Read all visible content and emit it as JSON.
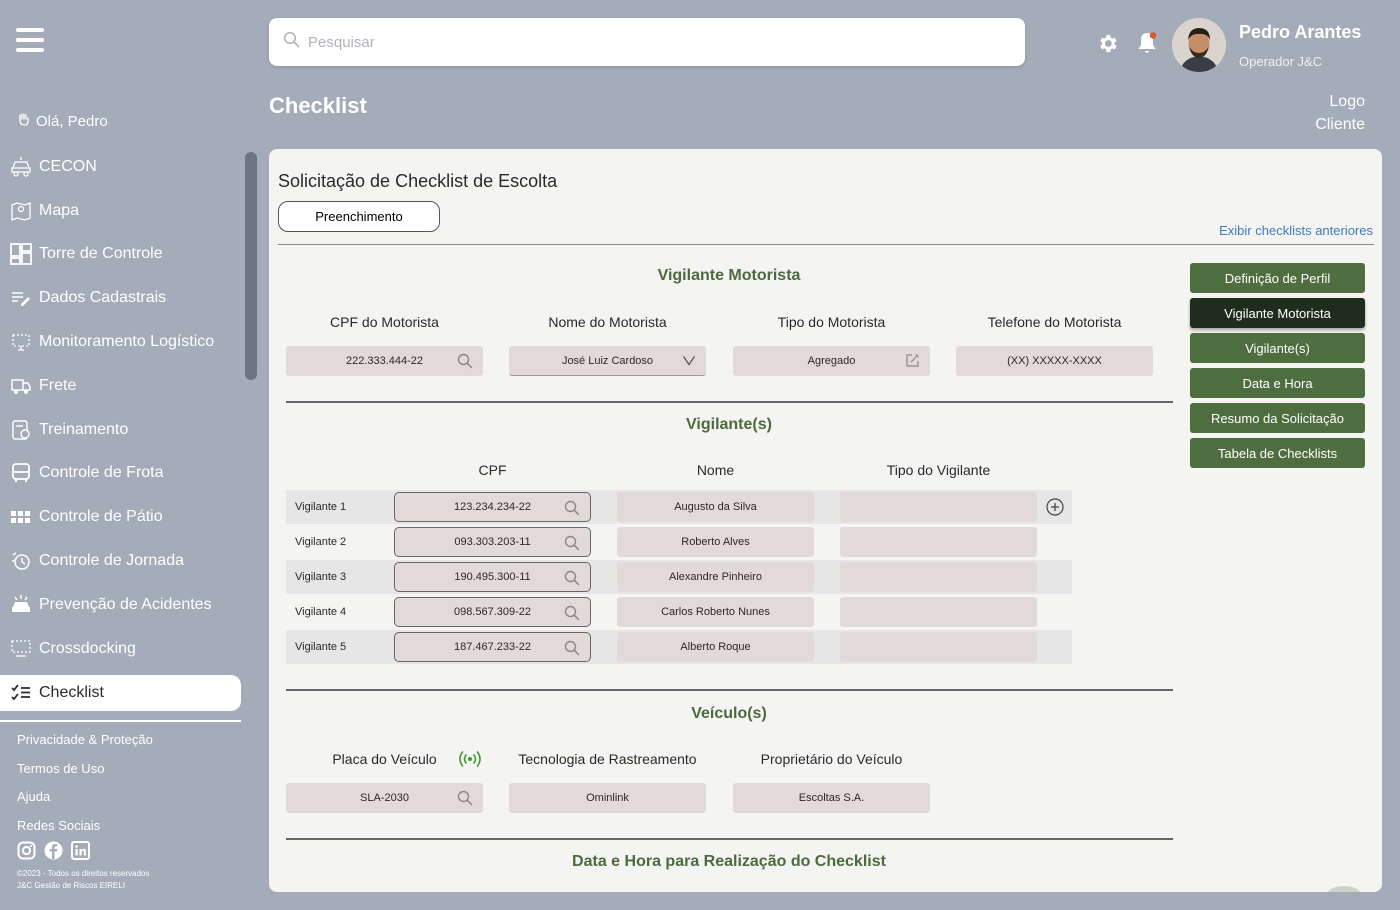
{
  "sidebar": {
    "greeting": "Olá, Pedro",
    "items": [
      {
        "label": "CECON",
        "icon": "car-icon"
      },
      {
        "label": "Mapa",
        "icon": "map-icon"
      },
      {
        "label": "Torre de Controle",
        "icon": "dashboard-icon"
      },
      {
        "label": "Dados Cadastrais",
        "icon": "edit-list-icon"
      },
      {
        "label": "Monitoramento Logístico",
        "icon": "monitor-icon"
      },
      {
        "label": "Frete",
        "icon": "truck-icon"
      },
      {
        "label": "Treinamento",
        "icon": "training-icon"
      },
      {
        "label": "Controle de Frota",
        "icon": "bus-icon"
      },
      {
        "label": "Controle de Pátio",
        "icon": "grid-icon"
      },
      {
        "label": "Controle de Jornada",
        "icon": "clock-icon"
      },
      {
        "label": "Prevenção de Acidentes",
        "icon": "accident-icon"
      },
      {
        "label": "Crossdocking",
        "icon": "crossdock-icon"
      },
      {
        "label": "Checklist",
        "icon": "checklist-icon",
        "active": true
      }
    ],
    "footer_links": [
      "Privacidade & Proteção",
      "Termos de Uso",
      "Ajuda",
      "Redes Sociais"
    ],
    "copyright_line1": "©2023 - Todos os direitos reservados",
    "copyright_line2": "J&C Gestão de Riscos EIRELI"
  },
  "header": {
    "search_placeholder": "Pesquisar",
    "user_name": "Pedro Arantes",
    "user_role": "Operador J&C",
    "logo_line1": "Logo",
    "logo_line2": "Cliente"
  },
  "page_title": "Checklist",
  "card": {
    "title": "Solicitação de Checklist de Escolta",
    "fill_button": "Preenchimento",
    "prev_link": "Exibir checklists anteriores",
    "driver": {
      "section_title": "Vigilante Motorista",
      "labels": [
        "CPF do Motorista",
        "Nome do Motorista",
        "Tipo do Motorista",
        "Telefone do Motorista"
      ],
      "cpf": "222.333.444-22",
      "name": "José Luiz Cardoso",
      "type": "Agregado",
      "phone": "(XX) XXXXX-XXXX"
    },
    "guards": {
      "section_title": "Vigilante(s)",
      "labels": [
        "CPF",
        "Nome",
        "Tipo do Vigilante"
      ],
      "rows": [
        {
          "label": "Vigilante 1",
          "cpf": "123.234.234-22",
          "name": "Augusto da Silva",
          "type": ""
        },
        {
          "label": "Vigilante 2",
          "cpf": "093.303.203-11",
          "name": "Roberto Alves",
          "type": ""
        },
        {
          "label": "Vigilante 3",
          "cpf": "190.495.300-11",
          "name": "Alexandre Pinheiro",
          "type": ""
        },
        {
          "label": "Vigilante 4",
          "cpf": "098.567.309-22",
          "name": "Carlos Roberto Nunes",
          "type": ""
        },
        {
          "label": "Vigilante 5",
          "cpf": "187.467.233-22",
          "name": "Alberto Roque",
          "type": ""
        }
      ]
    },
    "vehicles": {
      "section_title": "Veículo(s)",
      "labels": [
        "Placa do Veículo",
        "Tecnologia de Rastreamento",
        "Proprietário do Veículo"
      ],
      "plate": "SLA-2030",
      "tracking": "Ominlink",
      "owner": "Escoltas S.A."
    },
    "datetime_section_title": "Data e Hora para Realização do Checklist",
    "right_buttons": [
      {
        "label": "Definição de Perfil",
        "active": false
      },
      {
        "label": "Vigilante Motorista",
        "active": true
      },
      {
        "label": "Vigilante(s)",
        "active": false
      },
      {
        "label": "Data e Hora",
        "active": false
      },
      {
        "label": "Resumo da Solicitação",
        "active": false
      },
      {
        "label": "Tabela de Checklists",
        "active": false
      }
    ]
  }
}
